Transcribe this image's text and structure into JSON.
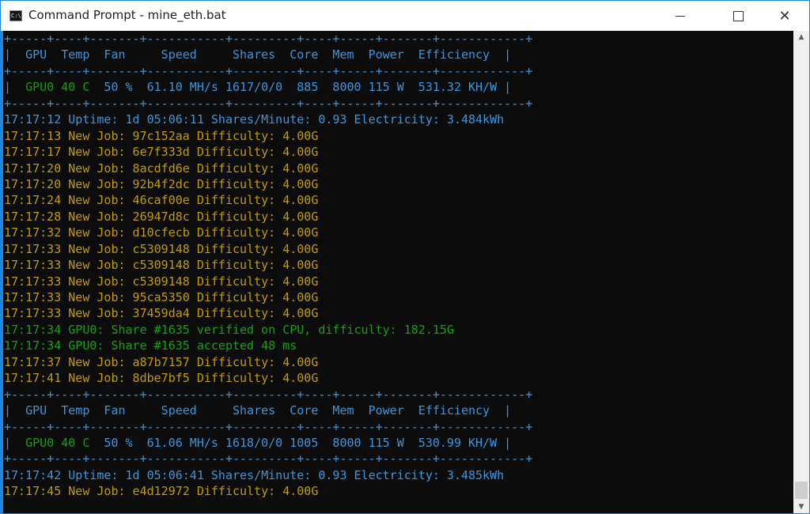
{
  "window": {
    "title": "Command Prompt - mine_eth.bat",
    "icon": "cmd-icon",
    "icon_text": "C:\\",
    "buttons": {
      "minimize": "minimize-icon",
      "maximize": "maximize-icon",
      "close": "close-icon",
      "close_glyph": "✕"
    }
  },
  "colors": {
    "table": "#3a96dd",
    "job": "#c19c00",
    "share": "#13a10e",
    "background": "#0c0c0c"
  },
  "console": {
    "lines": [
      {
        "text": "+-----+----+-------+-----------+---------+----+-----+-------+------------+",
        "color": "blue"
      },
      {
        "text": "|  GPU  Temp  Fan     Speed     Shares  Core  Mem  Power  Efficiency  |",
        "color": "blue"
      },
      {
        "text": "+-----+----+-------+-----------+---------+----+-----+-------+------------+",
        "color": "blue"
      },
      {
        "text": "|  GPU0 40 C  50 %  61.10 MH/s 1617/0/0  885  8000 115 W  531.32 KH/W |",
        "color": "blue",
        "gpu_green": true
      },
      {
        "text": "+-----+----+-------+-----------+---------+----+-----+-------+------------+",
        "color": "blue"
      },
      {
        "text": "17:17:12 Uptime: 1d 05:06:11 Shares/Minute: 0.93 Electricity: 3.484kWh",
        "color": "blue"
      },
      {
        "text": "17:17:13 New Job: 97c152aa Difficulty: 4.00G",
        "color": "yellow"
      },
      {
        "text": "17:17:17 New Job: 6e7f333d Difficulty: 4.00G",
        "color": "yellow"
      },
      {
        "text": "17:17:20 New Job: 8acdfd6e Difficulty: 4.00G",
        "color": "yellow"
      },
      {
        "text": "17:17:20 New Job: 92b4f2dc Difficulty: 4.00G",
        "color": "yellow"
      },
      {
        "text": "17:17:24 New Job: 46caf00e Difficulty: 4.00G",
        "color": "yellow"
      },
      {
        "text": "17:17:28 New Job: 26947d8c Difficulty: 4.00G",
        "color": "yellow"
      },
      {
        "text": "17:17:32 New Job: d10cfecb Difficulty: 4.00G",
        "color": "yellow"
      },
      {
        "text": "17:17:33 New Job: c5309148 Difficulty: 4.00G",
        "color": "yellow"
      },
      {
        "text": "17:17:33 New Job: c5309148 Difficulty: 4.00G",
        "color": "yellow"
      },
      {
        "text": "17:17:33 New Job: c5309148 Difficulty: 4.00G",
        "color": "yellow"
      },
      {
        "text": "17:17:33 New Job: 95ca5350 Difficulty: 4.00G",
        "color": "yellow"
      },
      {
        "text": "17:17:33 New Job: 37459da4 Difficulty: 4.00G",
        "color": "yellow"
      },
      {
        "text": "17:17:34 GPU0: Share #1635 verified on CPU, difficulty: 182.15G",
        "color": "green"
      },
      {
        "text": "17:17:34 GPU0: Share #1635 accepted 48 ms",
        "color": "green"
      },
      {
        "text": "17:17:37 New Job: a87b7157 Difficulty: 4.00G",
        "color": "yellow"
      },
      {
        "text": "17:17:41 New Job: 8dbe7bf5 Difficulty: 4.00G",
        "color": "yellow"
      },
      {
        "text": "+-----+----+-------+-----------+---------+----+-----+-------+------------+",
        "color": "blue"
      },
      {
        "text": "|  GPU  Temp  Fan     Speed     Shares  Core  Mem  Power  Efficiency  |",
        "color": "blue"
      },
      {
        "text": "+-----+----+-------+-----------+---------+----+-----+-------+------------+",
        "color": "blue"
      },
      {
        "text": "|  GPU0 40 C  50 %  61.06 MH/s 1618/0/0 1005  8000 115 W  530.99 KH/W |",
        "color": "blue",
        "gpu_green": true
      },
      {
        "text": "+-----+----+-------+-----------+---------+----+-----+-------+------------+",
        "color": "blue"
      },
      {
        "text": "17:17:42 Uptime: 1d 05:06:41 Shares/Minute: 0.93 Electricity: 3.485kWh",
        "color": "blue"
      },
      {
        "text": "17:17:45 New Job: e4d12972 Difficulty: 4.00G",
        "color": "yellow"
      }
    ]
  },
  "scrollbar": {
    "up": "scroll-up-arrow-icon",
    "down": "scroll-down-arrow-icon",
    "up_glyph": "▲",
    "down_glyph": "▼"
  }
}
